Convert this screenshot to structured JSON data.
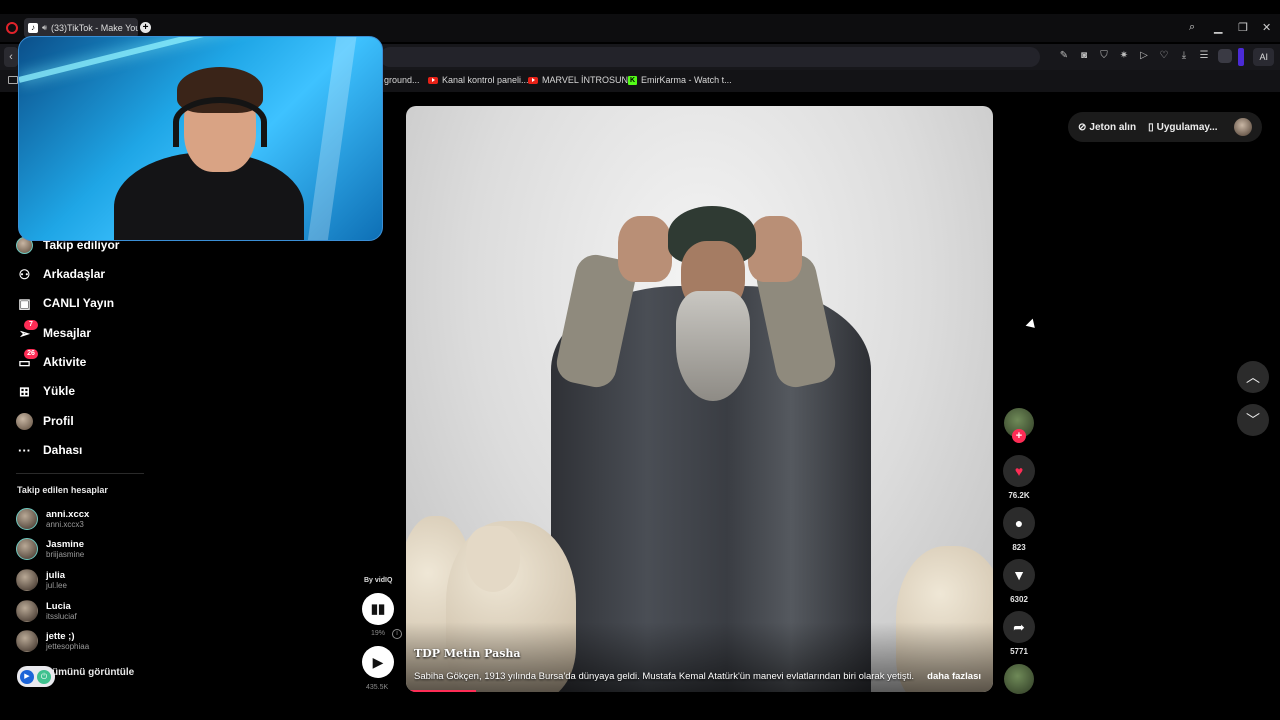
{
  "browser": {
    "tab_title": "(33)TikTok - Make You",
    "tab_audio_icon": "speaker-icon",
    "new_tab": "+",
    "ai_button": "AI",
    "bookmarks": [
      {
        "label": "ground...",
        "icon": "none"
      },
      {
        "label": "Kanal kontrol paneli...",
        "icon": "youtube-icon"
      },
      {
        "label": "MARVEL İNTROSUN...",
        "icon": "youtube-icon"
      },
      {
        "label": "EmirKarma - Watch t...",
        "icon": "kick-icon"
      }
    ]
  },
  "sidebar": {
    "nav": [
      {
        "label": "Takip ediliyor",
        "icon": "following-icon",
        "badge": ""
      },
      {
        "label": "Arkadaşlar",
        "icon": "friends-icon",
        "badge": ""
      },
      {
        "label": "CANLI Yayın",
        "icon": "live-icon",
        "badge": ""
      },
      {
        "label": "Mesajlar",
        "icon": "messages-icon",
        "badge": "7"
      },
      {
        "label": "Aktivite",
        "icon": "activity-icon",
        "badge": "26"
      },
      {
        "label": "Yükle",
        "icon": "upload-icon",
        "badge": ""
      },
      {
        "label": "Profil",
        "icon": "profile-avatar",
        "badge": ""
      },
      {
        "label": "Dahası",
        "icon": "more-icon",
        "badge": ""
      }
    ],
    "following_title": "Takip edilen hesaplar",
    "accounts": [
      {
        "name": "anni.xccx",
        "handle": "anni.xccx3"
      },
      {
        "name": "Jasmine",
        "handle": "briijasmine"
      },
      {
        "name": "julia",
        "handle": "jul.lee"
      },
      {
        "name": "Lucia",
        "handle": "itssluciaf"
      },
      {
        "name": "jette ;)",
        "handle": "jettesophiaa"
      }
    ],
    "see_more": "ümünü görüntüle"
  },
  "vidiq": {
    "by": "By vidIQ",
    "percent": "19%",
    "views": "435.5K"
  },
  "video": {
    "author": "TDP Metin Pasha",
    "caption": "Sabiha Gökçen, 1913 yılında Bursa'da dünyaya geldi. Mustafa Kemal Atatürk'ün manevi evlatlarından biri olarak yetişti.",
    "more": "daha fazlası",
    "progress": 0.12
  },
  "actions": {
    "likes": "76.2K",
    "comments": "823",
    "saves": "6302",
    "shares": "5771"
  },
  "top_bar": {
    "coins": "Jeton alın",
    "app": "Uygulamay..."
  },
  "colors": {
    "accent": "#fe2c55",
    "background": "#000000"
  }
}
